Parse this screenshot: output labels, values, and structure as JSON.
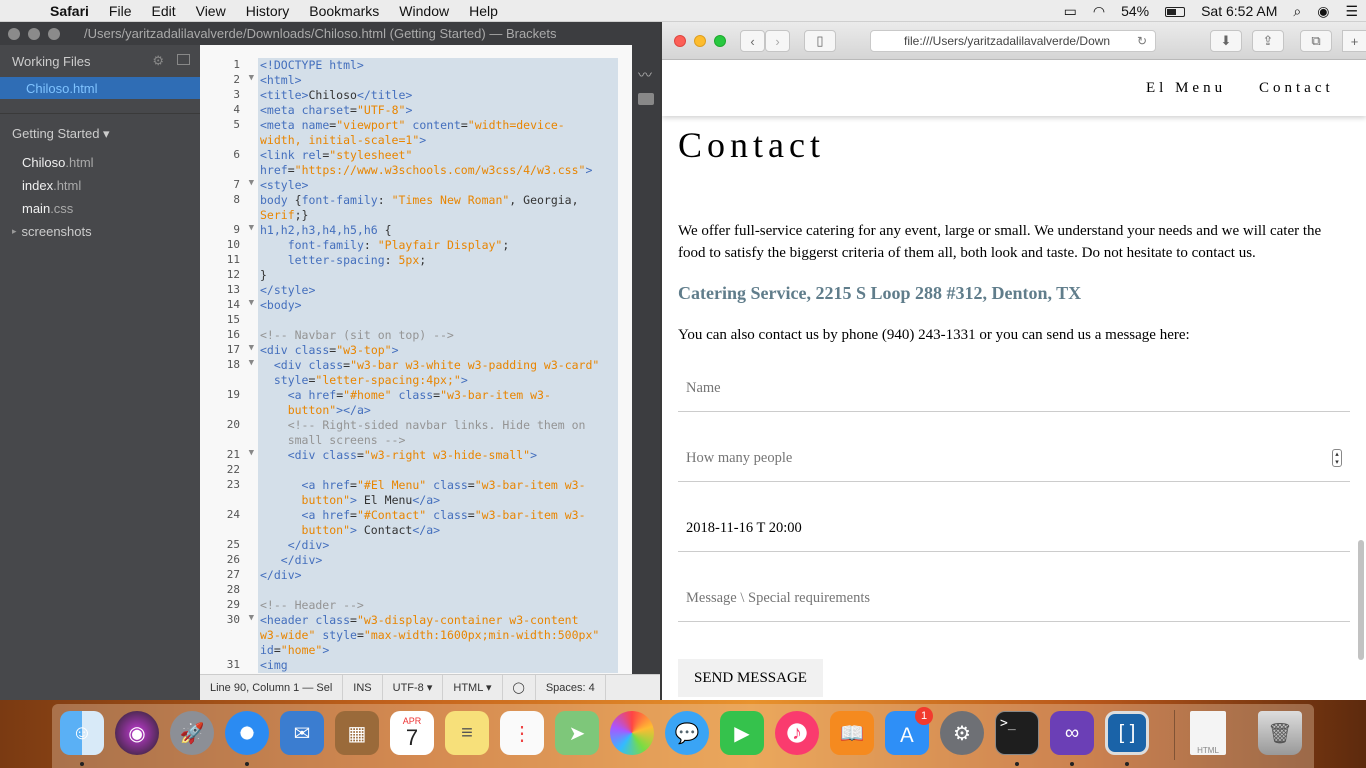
{
  "menubar": {
    "app": "Safari",
    "items": [
      "File",
      "Edit",
      "View",
      "History",
      "Bookmarks",
      "Window",
      "Help"
    ],
    "battery": "54%",
    "clock": "Sat 6:52 AM"
  },
  "brackets": {
    "title": "/Users/yaritzadalilavalverde/Downloads/Chiloso.html (Getting Started) — Brackets",
    "working_files_label": "Working Files",
    "working_file": "Chiloso.html",
    "project_label": "Getting Started ▾",
    "files": [
      {
        "name": "Chiloso",
        "ext": ".html"
      },
      {
        "name": "index",
        "ext": ".html"
      },
      {
        "name": "main",
        "ext": ".css"
      }
    ],
    "folder": "screenshots",
    "status": {
      "position": "Line 90, Column 1 — Sel",
      "mode": "INS",
      "encoding": "UTF-8 ▾",
      "language": "HTML ▾",
      "spaces": "Spaces:  4"
    }
  },
  "safari": {
    "url": "file:///Users/yaritzadalilavalverde/Down",
    "nav": {
      "menu": "El Menu",
      "contact": "Contact"
    },
    "heading": "Contact",
    "intro": "We offer full-service catering for any event, large or small. We understand your needs and we will cater the food to satisfy the biggerst criteria of them all, both look and taste. Do not hesitate to contact us.",
    "address": "Catering Service, 2215 S Loop 288 #312, Denton, TX",
    "phone_line": "You can also contact us by phone (940) 243-1331 or you can send us a message here:",
    "form": {
      "name_placeholder": "Name",
      "people_placeholder": "How many people",
      "datetime_value": "2018-11-16 T 20:00",
      "message_placeholder": "Message \\ Special requirements",
      "send_label": "SEND MESSAGE"
    }
  },
  "dock": {
    "calendar_month": "APR",
    "calendar_day": "7",
    "appstore_badge": "1"
  }
}
